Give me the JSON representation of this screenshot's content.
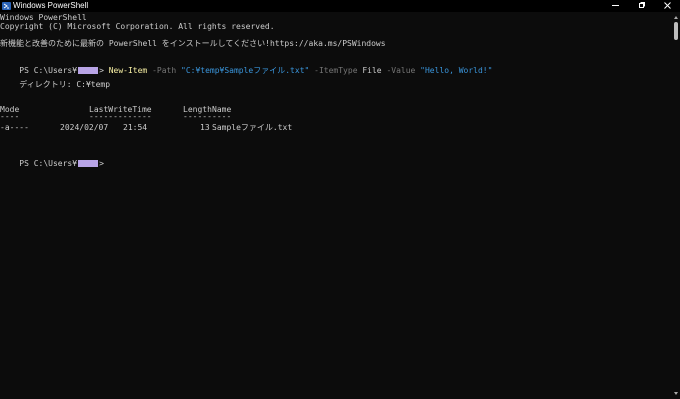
{
  "window": {
    "title": "Windows PowerShell",
    "icon": "powershell-icon",
    "controls": {
      "minimize": "minimize-icon",
      "maximize": "maximize-icon",
      "close": "close-icon"
    }
  },
  "terminal": {
    "banner1": "Windows PowerShell",
    "banner2": "Copyright (C) Microsoft Corporation. All rights reserved.",
    "banner3": "新機能と改善のために最新の PowerShell をインストールしてください!https://aka.ms/PSWindows",
    "prompt_prefix": "PS C:\\Users¥",
    "prompt_suffix": ">",
    "command": {
      "cmdlet": "New-Item",
      "path_param": "-Path",
      "path_value": "\"C:¥temp¥Sampleファイル.txt\"",
      "type_param": "-ItemType",
      "type_value": "File",
      "value_param": "-Value",
      "value_value": "\"Hello, World!\""
    },
    "directory_line": "    ディレクトリ: C:¥temp",
    "table": {
      "headers": {
        "mode": "Mode",
        "lastwrite": "LastWriteTime",
        "length": "Length",
        "name": "Name"
      },
      "underlines": {
        "mode": "----",
        "lastwrite": "-------------",
        "length": "------",
        "name": "----"
      },
      "rows": [
        {
          "mode": "-a----",
          "date": "2024/02/07",
          "time": "21:54",
          "length": "13",
          "name": "Sampleファイル.txt"
        }
      ]
    }
  },
  "colors": {
    "background": "#0c0c0c",
    "text": "#cccccc",
    "cmdlet": "#f9f1a5",
    "parameter": "#767676",
    "string": "#3a96dd",
    "masked_username": "#b8a4e6"
  }
}
